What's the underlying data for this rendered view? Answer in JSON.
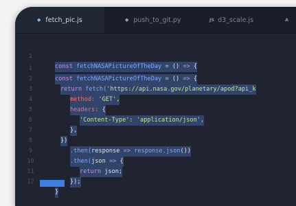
{
  "tabs": [
    {
      "label": "fetch_pic.js",
      "icon": "diamond-icon",
      "active": true
    },
    {
      "label": "push_to_git.py",
      "icon": "diamond-icon",
      "active": false
    },
    {
      "label": "d3_scale.js",
      "icon": "js-icon",
      "icon_text": "JS",
      "active": false
    },
    {
      "label": "",
      "icon": "tab-icon",
      "active": false
    }
  ],
  "tab_icons": {
    "diamond": "◆",
    "small": "A"
  },
  "line_numbers": [
    "1",
    "1",
    "2",
    "3",
    "4",
    "5",
    "6",
    "7",
    "8",
    "9",
    "10",
    "11",
    "12"
  ],
  "code": {
    "l0": [
      "const",
      "fetchNASAPictureOfTheDay",
      "=",
      "()",
      "=>",
      "{"
    ],
    "l1": [
      "const",
      "fetchNASAPictureOfTheDay",
      "=",
      "()",
      "=>",
      "{"
    ],
    "l2": [
      "return",
      "fetch(",
      "'https://api.nasa.gov/planetary/apod?api_k"
    ],
    "l3": [
      "method:",
      "'GET',"
    ],
    "l4": [
      "headers:",
      "{"
    ],
    "l5": [
      "'Content-Type':",
      "'application/json',"
    ],
    "l6": [
      "},"
    ],
    "l7": [
      "})"
    ],
    "l8": [
      ".then(",
      "response",
      "=>",
      "response.json",
      "())"
    ],
    "l9": [
      ".then(",
      "json",
      "=>",
      "{"
    ],
    "l10": [
      "return",
      "json;"
    ],
    "l11": [
      "});"
    ],
    "l12": [
      "}"
    ]
  },
  "colors": {
    "editor_bg": "#1f2430",
    "selection": "#445e9b",
    "keyword": "#c792ea",
    "function": "#82aaff",
    "string": "#c3e88d",
    "accent": "#3f7de0"
  }
}
